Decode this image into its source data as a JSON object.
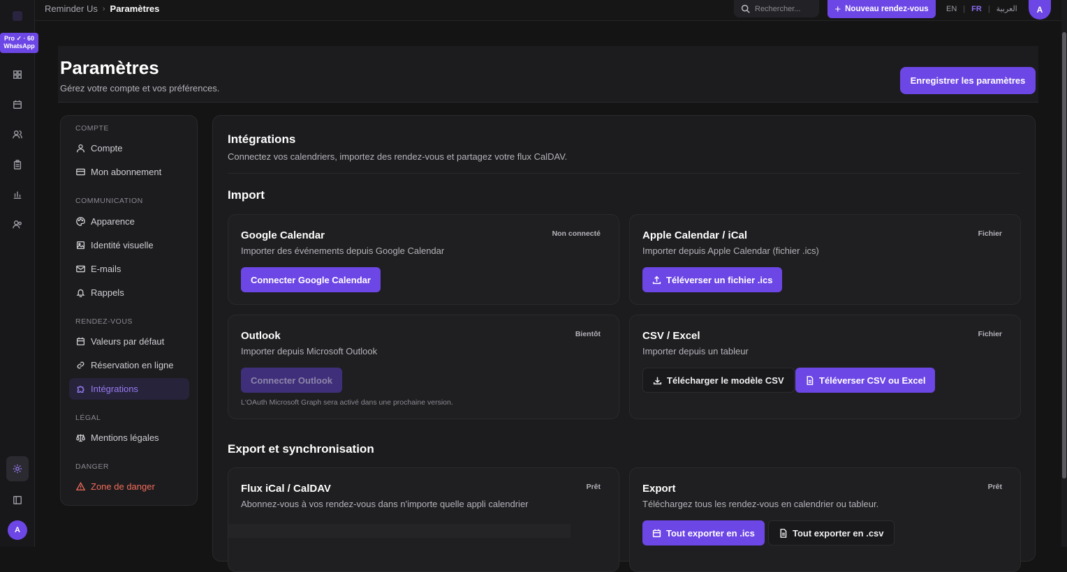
{
  "rail": {
    "pro_line1": "Pro ✓ · 60",
    "pro_line2": "WhatsApp",
    "avatar_initial": "A"
  },
  "topbar": {
    "breadcrumb_root": "Reminder Us",
    "breadcrumb_sep": "›",
    "breadcrumb_current": "Paramètres",
    "search_placeholder": "Rechercher...",
    "new_button": "Nouveau rendez-vous",
    "lang_en": "EN",
    "lang_fr": "FR",
    "lang_ar": "العربية",
    "lang_sep": "|",
    "avatar_initial": "A"
  },
  "header": {
    "title": "Paramètres",
    "subtitle": "Gérez votre compte et vos préférences.",
    "save_button": "Enregistrer les paramètres"
  },
  "nav": {
    "sections": [
      {
        "label": "COMPTE",
        "items": [
          {
            "label": "Compte",
            "icon": "user-icon"
          },
          {
            "label": "Mon abonnement",
            "icon": "card-icon"
          }
        ]
      },
      {
        "label": "COMMUNICATION",
        "items": [
          {
            "label": "Apparence",
            "icon": "palette-icon"
          },
          {
            "label": "Identité visuelle",
            "icon": "image-icon"
          },
          {
            "label": "E-mails",
            "icon": "mail-icon"
          },
          {
            "label": "Rappels",
            "icon": "bell-icon"
          }
        ]
      },
      {
        "label": "RENDEZ-VOUS",
        "items": [
          {
            "label": "Valeurs par défaut",
            "icon": "calendar-icon"
          },
          {
            "label": "Réservation en ligne",
            "icon": "link-icon"
          },
          {
            "label": "Intégrations",
            "icon": "puzzle-icon"
          }
        ]
      },
      {
        "label": "LÉGAL",
        "items": [
          {
            "label": "Mentions légales",
            "icon": "scale-icon"
          }
        ]
      },
      {
        "label": "DANGER",
        "items": [
          {
            "label": "Zone de danger",
            "icon": "warning-icon"
          }
        ]
      }
    ],
    "active": "Intégrations"
  },
  "panel": {
    "title": "Intégrations",
    "subtitle": "Connectez vos calendriers, importez des rendez-vous et partagez votre flux CalDAV.",
    "import_heading": "Import",
    "export_heading": "Export et synchronisation",
    "cards": {
      "google": {
        "title": "Google Calendar",
        "desc": "Importer des événements depuis Google Calendar",
        "badge": "Non connecté",
        "button": "Connecter Google Calendar"
      },
      "apple": {
        "title": "Apple Calendar / iCal",
        "desc": "Importer depuis Apple Calendar (fichier .ics)",
        "badge": "Fichier",
        "button": "Téléverser un fichier .ics"
      },
      "outlook": {
        "title": "Outlook",
        "desc": "Importer depuis Microsoft Outlook",
        "badge": "Bientôt",
        "button": "Connecter Outlook",
        "note": "L'OAuth Microsoft Graph sera activé dans une prochaine version."
      },
      "csv": {
        "title": "CSV / Excel",
        "desc": "Importer depuis un tableur",
        "badge": "Fichier",
        "button_template": "Télécharger le modèle CSV",
        "button_upload": "Téléverser CSV ou Excel"
      },
      "ical_feed": {
        "title": "Flux iCal / CalDAV",
        "desc": "Abonnez-vous à vos rendez-vous dans n'importe quelle appli calendrier",
        "badge": "Prêt"
      },
      "export": {
        "title": "Export",
        "desc": "Téléchargez tous les rendez-vous en calendrier ou tableur.",
        "badge": "Prêt",
        "button_ics": "Tout exporter en .ics",
        "button_csv": "Tout exporter en .csv"
      }
    }
  },
  "colors": {
    "accent": "#6d46e6",
    "background": "#141415",
    "danger": "#f26b5a"
  }
}
